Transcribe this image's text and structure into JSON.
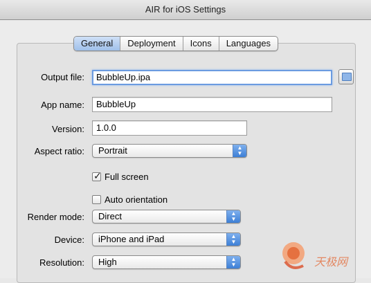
{
  "window": {
    "title": "AIR for iOS Settings"
  },
  "tabs": [
    "General",
    "Deployment",
    "Icons",
    "Languages"
  ],
  "active_tab": "General",
  "form": {
    "output_file": {
      "label": "Output file:",
      "value": "BubbleUp.ipa"
    },
    "app_name": {
      "label": "App name:",
      "value": "BubbleUp"
    },
    "version": {
      "label": "Version:",
      "value": "1.0.0"
    },
    "aspect_ratio": {
      "label": "Aspect ratio:",
      "value": "Portrait"
    },
    "full_screen": {
      "label": "Full screen",
      "checked": true
    },
    "auto_orientation": {
      "label": "Auto orientation",
      "checked": false
    },
    "render_mode": {
      "label": "Render mode:",
      "value": "Direct"
    },
    "device": {
      "label": "Device:",
      "value": "iPhone and iPad"
    },
    "resolution": {
      "label": "Resolution:",
      "value": "High"
    }
  },
  "watermark": {
    "text": "天极网"
  },
  "colors": {
    "focus_ring": "#6b9be0",
    "tab_active": "#9fc0ea",
    "stepper": "#3d7fd6"
  }
}
